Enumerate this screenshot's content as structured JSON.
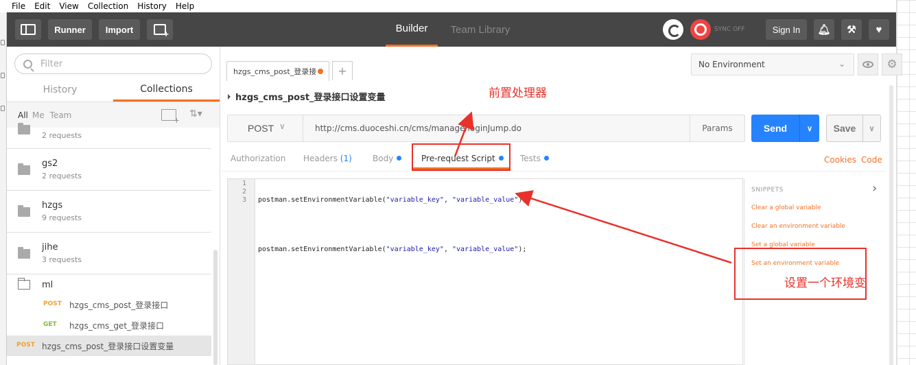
{
  "menu": [
    "File",
    "Edit",
    "View",
    "Collection",
    "History",
    "Help"
  ],
  "header": {
    "runner": "Runner",
    "import": "Import",
    "builder": "Builder",
    "team_library": "Team Library",
    "sync": "SYNC OFF",
    "signin": "Sign In"
  },
  "sidebar": {
    "filter_placeholder": "Filter",
    "tabs": [
      "History",
      "Collections"
    ],
    "filters": [
      "All",
      "Me",
      "Team"
    ],
    "collections": [
      {
        "name": "",
        "count": "2 requests"
      },
      {
        "name": "gs2",
        "count": "2 requests"
      },
      {
        "name": "hzgs",
        "count": "9 requests"
      },
      {
        "name": "jihe",
        "count": "3 requests"
      },
      {
        "name": "ml",
        "count": ""
      }
    ],
    "requests": [
      {
        "method": "POST",
        "name": "hzgs_cms_post_登录接口"
      },
      {
        "method": "GET",
        "name": "hzgs_cms_get_登录接口"
      }
    ],
    "selected_request": {
      "method": "POST",
      "name": "hzgs_cms_post_登录接口设置变量"
    }
  },
  "main": {
    "tab_label": "hzgs_cms_post_登录接",
    "add_tab": "+",
    "environment": "No Environment",
    "request_title": "hzgs_cms_post_登录接口设置变量",
    "method": "POST",
    "url": "http://cms.duoceshi.cn/cms/manage/loginJump.do",
    "params": "Params",
    "send": "Send",
    "save": "Save",
    "subtabs": {
      "authorization": "Authorization",
      "headers": "Headers",
      "headers_count": "(1)",
      "body": "Body",
      "prerequest": "Pre-request Script",
      "tests": "Tests"
    },
    "cookies": "Cookies",
    "code": "Code",
    "editor_lines": [
      "1",
      "2",
      "3"
    ],
    "code_lines": [
      {
        "fn": "postman.setEnvironmentVariable(",
        "a": "\"variable_key\"",
        "sep": ", ",
        "b": "\"variable_value\"",
        "end": ");"
      },
      {
        "fn": "",
        "a": "",
        "sep": "",
        "b": "",
        "end": ""
      },
      {
        "fn": "postman.setEnvironmentVariable(",
        "a": "\"variable_key\"",
        "sep": ", ",
        "b": "\"variable_value\"",
        "end": ");"
      }
    ],
    "snippets": {
      "title": "SNIPPETS",
      "items": [
        "Clear a global variable",
        "Clear an environment variable",
        "Set a global variable",
        "Set an environment variable"
      ]
    }
  },
  "annotations": {
    "preprocessor": "前置处理器",
    "set_env": "设置一个环境变"
  }
}
